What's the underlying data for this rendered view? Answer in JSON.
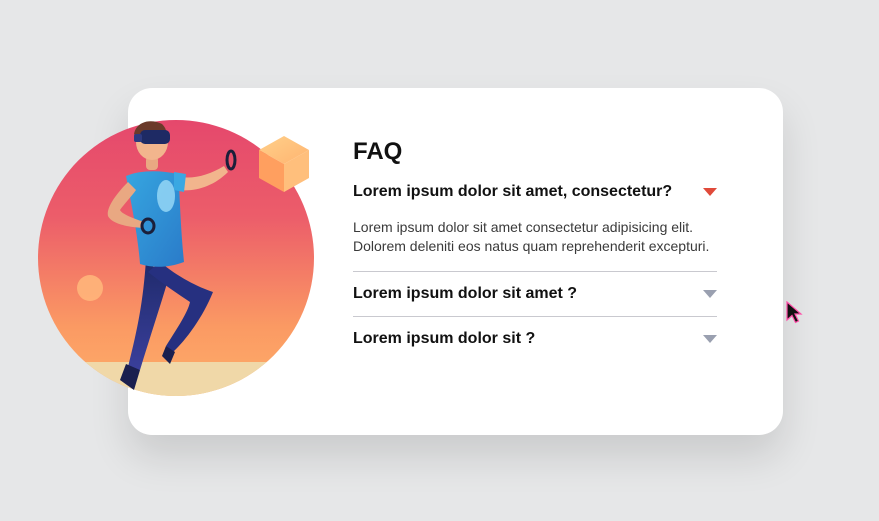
{
  "faq": {
    "title": "FAQ",
    "items": [
      {
        "question": "Lorem ipsum dolor sit amet, consectetur?",
        "answer": "Lorem ipsum dolor sit amet consectetur adipisicing elit. Dolorem deleniti eos natus quam reprehenderit excepturi.",
        "expanded": true,
        "chevron_icon": "triangle-down-icon"
      },
      {
        "question": "Lorem ipsum dolor sit amet ?",
        "expanded": false,
        "chevron_icon": "triangle-down-icon"
      },
      {
        "question": "Lorem ipsum dolor sit ?",
        "expanded": false,
        "chevron_icon": "triangle-down-icon"
      }
    ]
  },
  "illustration": {
    "subject": "vr-player",
    "icon": "vr-headset-person-icon"
  },
  "colors": {
    "background": "#e6e7e8",
    "card": "#ffffff",
    "text": "#111111",
    "answer_text": "#3a3a3a",
    "active_chevron": "#e04a3a",
    "inactive_chevron": "#9aa0b0",
    "circle_top": "#e5486c",
    "circle_bottom": "#fda767",
    "ground": "#f0d8a8",
    "cube": "#ffb06b",
    "divider": "#c9c9cf"
  }
}
